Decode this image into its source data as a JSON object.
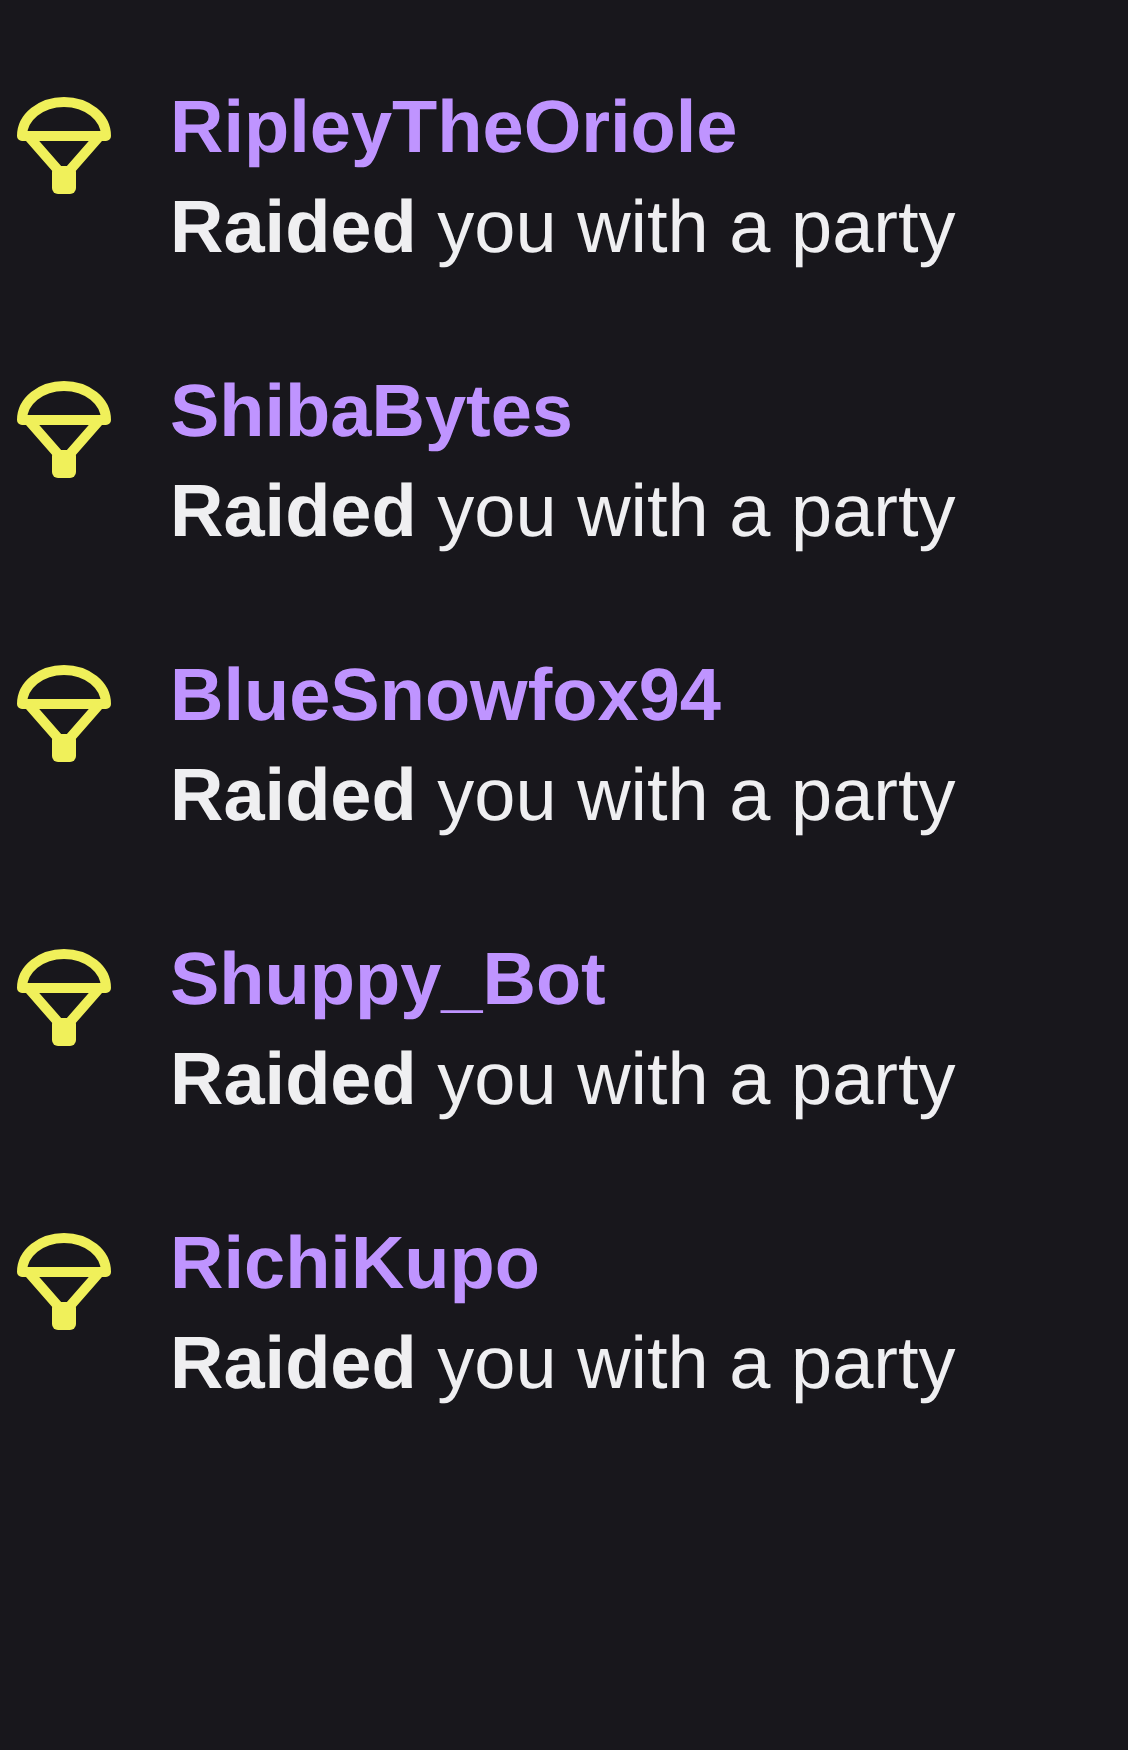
{
  "events": [
    {
      "username": "RipleyTheOriole",
      "message": "**Raided** you with a party"
    },
    {
      "username": "ShibaBytes",
      "message": "**Raided** you with a party"
    },
    {
      "username": "BlueSnowfox94",
      "message": "**Raided** you with a party"
    },
    {
      "username": "Shuppy_Bot",
      "message": "**Raided** you with a party"
    },
    {
      "username": "RichiKupo",
      "message": "**Raided** you with a party"
    }
  ]
}
